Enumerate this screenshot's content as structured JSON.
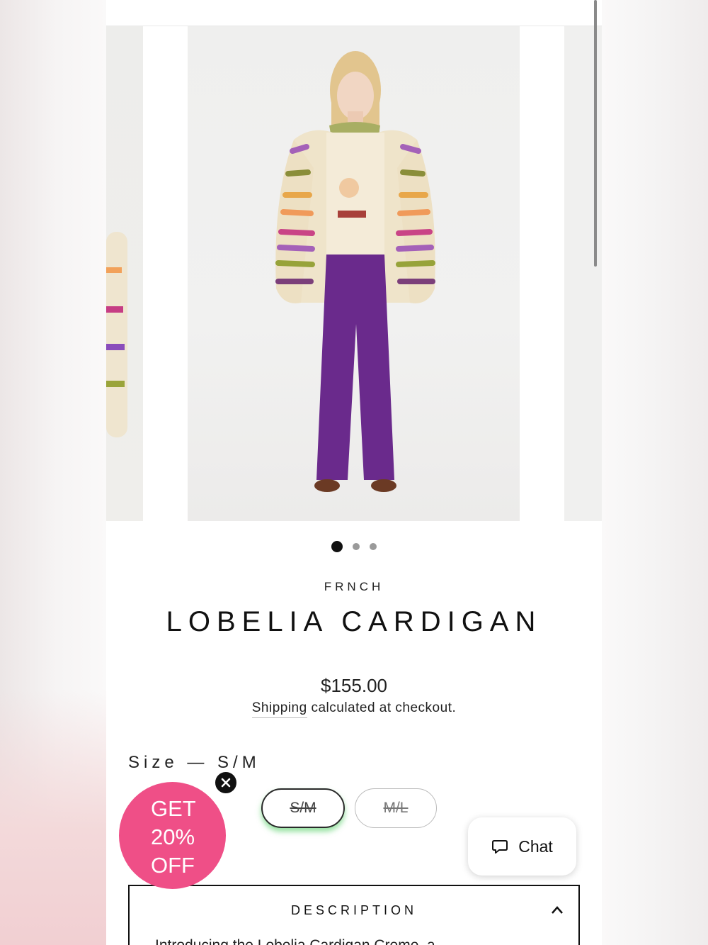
{
  "gallery": {
    "active_slide": 1,
    "slide_count": 3,
    "zoom_icon": "search-icon"
  },
  "product": {
    "vendor": "FRNCH",
    "title": "LOBELIA CARDIGAN",
    "price": "$155.00",
    "shipping_link": "Shipping",
    "shipping_rest": " calculated at checkout.",
    "size_label": "Size — S/M",
    "sizes": [
      {
        "label": "S/M",
        "selected": true,
        "unavailable": true
      },
      {
        "label": "M/L",
        "selected": false,
        "unavailable": true
      }
    ]
  },
  "description": {
    "title": "DESCRIPTION",
    "body_partial": "Introducing the Lobelia Cardigan Creme, a",
    "chevron_icon": "chevron-up-icon"
  },
  "promo": {
    "line1": "GET",
    "line2": "20%",
    "line3": "OFF",
    "color": "#ef4f87",
    "close_icon": "close-icon"
  },
  "chat": {
    "label": "Chat",
    "icon": "chat-bubble-icon"
  },
  "colors": {
    "selected_size_glow": "#3cc850",
    "text": "#111111"
  }
}
